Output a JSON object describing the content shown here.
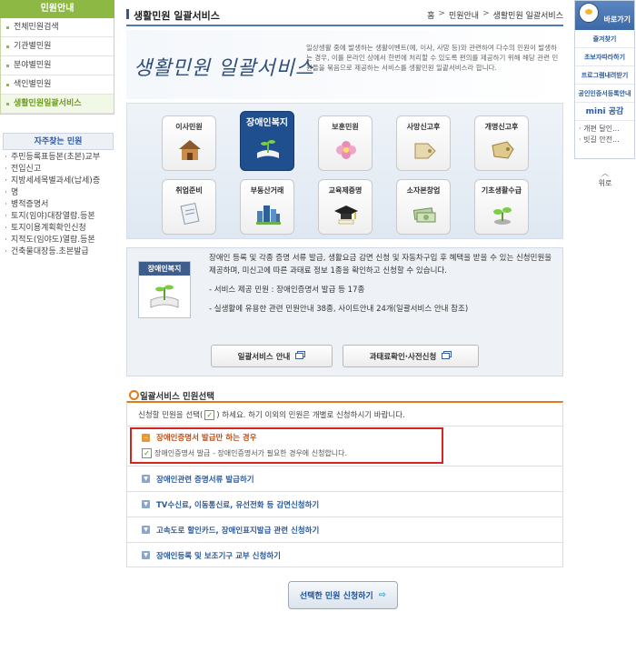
{
  "sidebar": {
    "header": "민원안내",
    "items": [
      {
        "label": "전체민원검색"
      },
      {
        "label": "기관별민원"
      },
      {
        "label": "분야별민원"
      },
      {
        "label": "색인별민원"
      },
      {
        "label": "생활민원일괄서비스",
        "active": true
      }
    ]
  },
  "favorites": {
    "header": "자주찾는 민원",
    "items": [
      "주민등록표등본(초본)교부",
      "전입신고",
      "지방세세목별과세(납세)증",
      "명",
      "병적증명서",
      "토지(임야)대장열람.등본",
      "토지이용계획확인신청",
      "지적도(임야도)열람.등본",
      "건축물대장등.초본발급"
    ]
  },
  "header": {
    "title": "생활민원 일괄서비스",
    "breadcrumb": [
      "홈",
      "민원안내",
      "생활민원 일괄서비스"
    ],
    "breadcrumb_sep": ">"
  },
  "intro": {
    "title": "생활민원 일괄서비스",
    "desc": "일상생활 중에 발생하는 생활이벤트(예, 이사, 사망 등)와 관련하여 다수의 민원이 발생하는 경우, 이를 온라인 상에서 한번에 처리할 수 있도록 편의를 제공하기 위해 해당 관련 민원들을 묶음으로 제공하는 서비스를 생활민원 일괄서비스라 합니다."
  },
  "services": [
    {
      "label": "이사민원",
      "icon": "house-icon"
    },
    {
      "label": "장애인복지",
      "icon": "book-sprout-icon",
      "selected": true
    },
    {
      "label": "보훈민원",
      "icon": "flower-icon"
    },
    {
      "label": "사망신고후",
      "icon": "tag-icon"
    },
    {
      "label": "개명신고후",
      "icon": "tag-icon"
    },
    {
      "label": "취업준비",
      "icon": "document-icon"
    },
    {
      "label": "부동산거래",
      "icon": "building-icon"
    },
    {
      "label": "교육제증명",
      "icon": "graduation-cap-icon"
    },
    {
      "label": "소자본창업",
      "icon": "money-icon"
    },
    {
      "label": "기초생활수급",
      "icon": "sprout-icon"
    }
  ],
  "detail": {
    "card_label": "장애인복지",
    "para1": "장애인 등록 및 각종 증명 서류 발급, 생활요금 감면 신청 및 자동차구입 후 혜택을 받을 수 있는 신청민원을 제공하며, 미신고에 따른 과태료 정보 1종을 확인하고 신청할 수 있습니다.",
    "para2": "- 서비스 제공 민원 : 장애인증명서 발급 등 17종",
    "para3": "- 실생활에 유용한 관련 민원안내 38종, 사이트안내 24개(일괄서비스 안내 참조)",
    "btn1": "일괄서비스 안내",
    "btn2": "과태료확인·사전신청"
  },
  "selection": {
    "title": "일괄서비스 민원선택",
    "instr_before": "신청할 민원을 선택(",
    "instr_after": ") 하세요. 하기 이외의 민원은 개별로 신청하시기 바랍니다.",
    "check_mark": "✓",
    "open_group": {
      "label": "장애인증명서 발급만 하는 경우",
      "sub_label": "장애인증명서 발급 - 장애인증명서가 필요한 경우에 신청합니다."
    },
    "groups": [
      "장애인관련 증명서류 발급하기",
      "TV수신료, 이동통신료, 유선전화 등 감면신청하기",
      "고속도로 할인카드, 장애인표지발급 관련 신청하기",
      "장애인등록 및 보조기구 교부 신청하기"
    ]
  },
  "submit": {
    "label": "선택한 민원 신청하기",
    "arrow": "⇨"
  },
  "quick_menu": {
    "title": "바로가기",
    "items": [
      "즐겨찾기",
      "초보자따라하기",
      "프로그램내려받기",
      "공인인증서등록안내"
    ],
    "mini_prefix": "mini",
    "mini_suffix": "공감",
    "news": [
      "· 개편 달인...",
      "· 빗길 안전..."
    ],
    "top_label": "위로",
    "top_arrow": "︿"
  }
}
